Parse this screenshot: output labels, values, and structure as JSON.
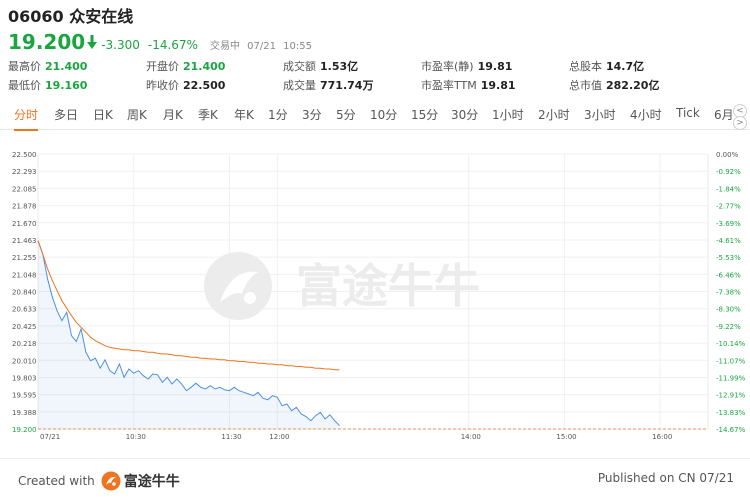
{
  "stock": {
    "code": "06060",
    "name": "众安在线"
  },
  "quote": {
    "price": "19.200",
    "change": "-3.300",
    "change_pct": "-14.67%",
    "status": "交易中",
    "date": "07/21",
    "time": "10:55"
  },
  "stats": [
    {
      "label": "最高价",
      "value": "21.400",
      "green": true
    },
    {
      "label": "开盘价",
      "value": "21.400",
      "green": true
    },
    {
      "label": "成交额",
      "value": "1.53亿",
      "green": false
    },
    {
      "label": "市盈率(静)",
      "value": "19.81",
      "green": false
    },
    {
      "label": "总股本",
      "value": "14.7亿",
      "green": false
    },
    {
      "label": "最低价",
      "value": "19.160",
      "green": true
    },
    {
      "label": "昨收价",
      "value": "22.500",
      "green": false
    },
    {
      "label": "成交量",
      "value": "771.74万",
      "green": false
    },
    {
      "label": "市盈率TTM",
      "value": "19.81",
      "green": false
    },
    {
      "label": "总市值",
      "value": "282.20亿",
      "green": false
    }
  ],
  "tabs": [
    "分时",
    "多日",
    "日K",
    "周K",
    "月K",
    "季K",
    "年K",
    "1分",
    "3分",
    "5分",
    "10分",
    "15分",
    "30分",
    "1小时",
    "2小时",
    "3小时",
    "4小时",
    "Tick",
    "6月："
  ],
  "tab_arrows": {
    "left": "<",
    "right": ">"
  },
  "watermark": "富途牛牛",
  "footer": {
    "created_prefix": "Created with",
    "brand": "富途牛牛",
    "published": "Published on CN 07/21"
  },
  "colors": {
    "down_green": "#1aa541",
    "accent_orange": "#f0741e",
    "price_line": "#4a90e2",
    "avg_line": "#f0741e"
  },
  "chart_data": {
    "type": "line",
    "ylim": [
      19.2,
      22.5
    ],
    "y_ticks": [
      "22.500",
      "22.293",
      "22.085",
      "21.878",
      "21.670",
      "21.463",
      "21.255",
      "21.048",
      "20.840",
      "20.633",
      "20.425",
      "20.218",
      "20.010",
      "19.803",
      "19.595",
      "19.388",
      "19.200"
    ],
    "pct_ticks": [
      "0.00%",
      "-0.92%",
      "-1.84%",
      "-2.77%",
      "-3.69%",
      "-4.61%",
      "-5.53%",
      "-6.46%",
      "-7.38%",
      "-8.30%",
      "-9.22%",
      "-10.14%",
      "-11.07%",
      "-11.99%",
      "-12.91%",
      "-13.83%",
      "-14.67%"
    ],
    "x_ticks": [
      "07/21",
      "10:30",
      "11:30",
      "12:00",
      "14:00",
      "15:00",
      "16:00"
    ],
    "session_minutes": 420,
    "x_tick_minutes": [
      0,
      60,
      120,
      150,
      270,
      330,
      390
    ],
    "last_price": 19.2,
    "series": [
      {
        "values": [
          21.46,
          21.3,
          21.0,
          20.78,
          20.62,
          20.5,
          20.6,
          20.32,
          20.25,
          20.4,
          20.12,
          20.02,
          20.05,
          19.93,
          20.03,
          19.9,
          19.86,
          19.98,
          19.82,
          19.92,
          19.87,
          19.9,
          19.84,
          19.8,
          19.86,
          19.85,
          19.76,
          19.82,
          19.74,
          19.8,
          19.74,
          19.66,
          19.7,
          19.75,
          19.7,
          19.68,
          19.72,
          19.68,
          19.7,
          19.67,
          19.66,
          19.7,
          19.66,
          19.64,
          19.62,
          19.6,
          19.64,
          19.57,
          19.55,
          19.6,
          19.58,
          19.48,
          19.5,
          19.42,
          19.46,
          19.38,
          19.35,
          19.3,
          19.36,
          19.4,
          19.32,
          19.37,
          19.3,
          19.24
        ]
      },
      {
        "values": [
          21.46,
          21.3,
          21.12,
          20.98,
          20.86,
          20.74,
          20.65,
          20.56,
          20.48,
          20.42,
          20.36,
          20.3,
          20.26,
          20.23,
          20.2,
          20.18,
          20.17,
          20.16,
          20.15,
          20.15,
          20.14,
          20.14,
          20.13,
          20.12,
          20.12,
          20.11,
          20.1,
          20.1,
          20.09,
          20.08,
          20.08,
          20.07,
          20.06,
          20.06,
          20.05,
          20.05,
          20.04,
          20.04,
          20.03,
          20.03,
          20.02,
          20.02,
          20.01,
          20.01,
          20.0,
          20.0,
          19.99,
          19.99,
          19.98,
          19.98,
          19.97,
          19.97,
          19.96,
          19.96,
          19.95,
          19.95,
          19.94,
          19.94,
          19.93,
          19.93,
          19.92,
          19.92,
          19.91,
          19.91
        ]
      }
    ]
  }
}
